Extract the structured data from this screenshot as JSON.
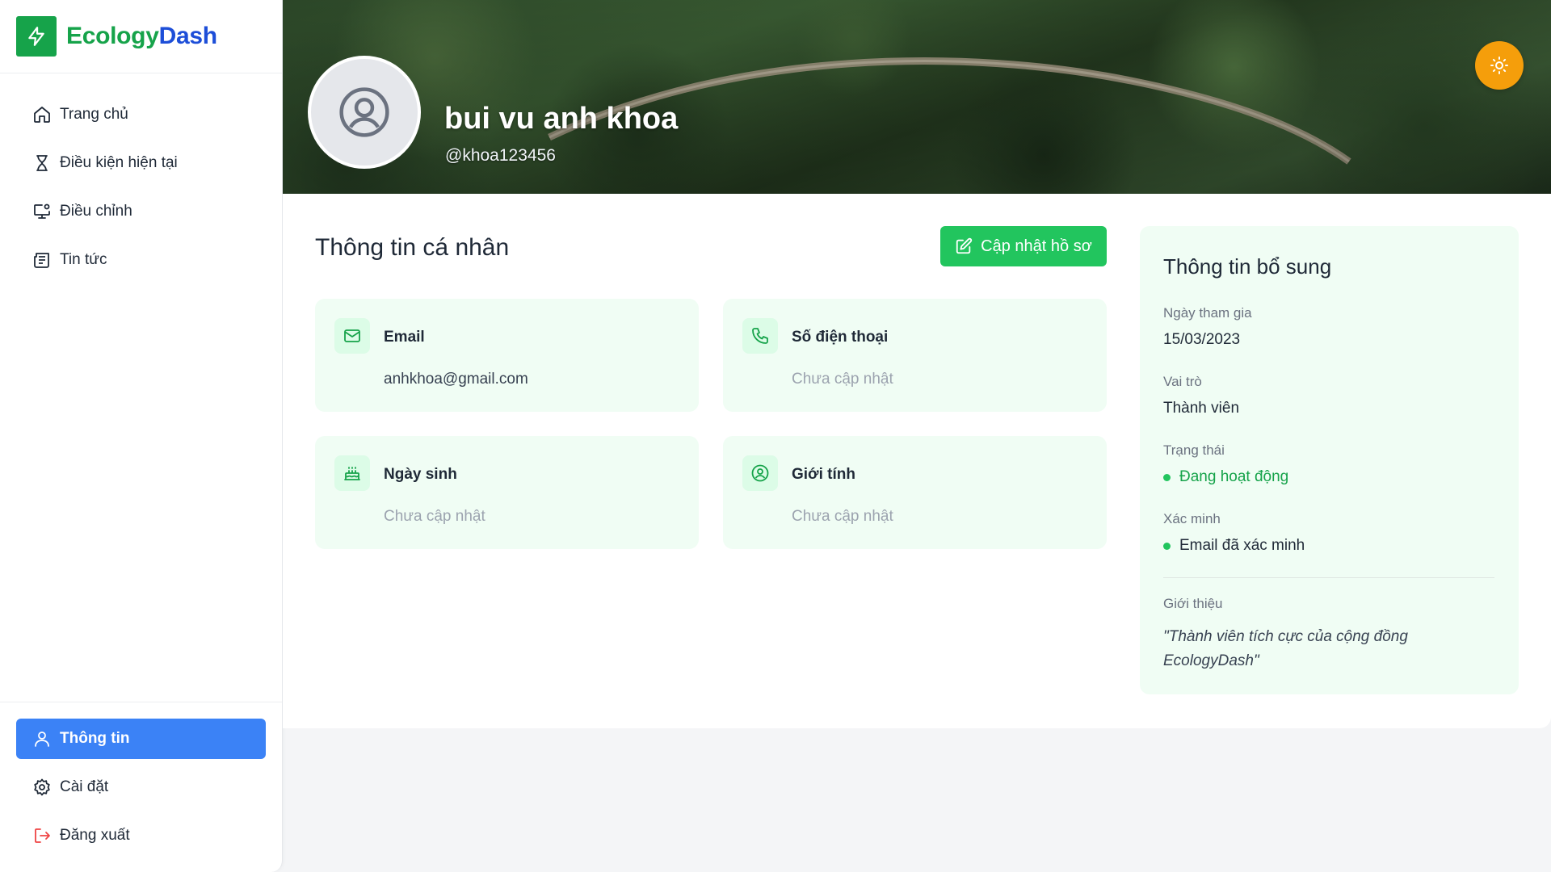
{
  "brand": {
    "name_part1": "Ecology",
    "name_part2": "Dash",
    "color_green": "#16a34a",
    "color_blue": "#1d4ed8"
  },
  "sidebar": {
    "items": [
      {
        "label": "Trang chủ",
        "icon": "home-icon"
      },
      {
        "label": "Điều kiện hiện tại",
        "icon": "hourglass-icon"
      },
      {
        "label": "Điều chỉnh",
        "icon": "monitor-settings-icon"
      },
      {
        "label": "Tin tức",
        "icon": "newspaper-icon"
      }
    ],
    "bottom_items": [
      {
        "label": "Thông tin",
        "icon": "user-icon",
        "active": true
      },
      {
        "label": "Cài đặt",
        "icon": "gear-icon"
      },
      {
        "label": "Đăng xuất",
        "icon": "logout-icon"
      }
    ],
    "active_color": "#3b82f6"
  },
  "profile": {
    "name": "bui vu anh khoa",
    "handle": "@khoa123456"
  },
  "personal": {
    "title": "Thông tin cá nhân",
    "update_button": "Cập nhật hồ sơ",
    "cards": [
      {
        "label": "Email",
        "value": "anhkhoa@gmail.com",
        "icon": "mail-icon"
      },
      {
        "label": "Số điện thoại",
        "value": "Chưa cập nhật",
        "icon": "phone-icon"
      },
      {
        "label": "Ngày sinh",
        "value": "Chưa cập nhật",
        "icon": "cake-icon"
      },
      {
        "label": "Giới tính",
        "value": "Chưa cập nhật",
        "icon": "user-circle-icon"
      }
    ]
  },
  "extra": {
    "title": "Thông tin bổ sung",
    "join_label": "Ngày tham gia",
    "join_value": "15/03/2023",
    "role_label": "Vai trò",
    "role_value": "Thành viên",
    "status_label": "Trạng thái",
    "status_value": "Đang hoạt động",
    "verify_label": "Xác minh",
    "verify_value": "Email đã xác minh",
    "intro_label": "Giới thiệu",
    "intro_value": "\"Thành viên tích cực của cộng đồng EcologyDash\""
  },
  "colors": {
    "accent_green": "#22c55e",
    "card_bg": "#f0fdf4",
    "theme_toggle": "#f59e0b"
  }
}
